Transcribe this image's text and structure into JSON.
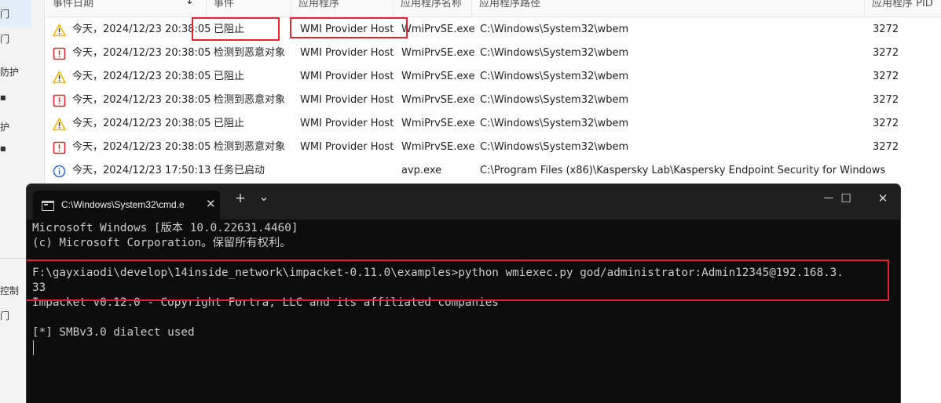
{
  "sidebar": {
    "fragments": [
      "门",
      "门",
      "防护",
      "■",
      "护",
      "■",
      "控制",
      "门"
    ]
  },
  "table": {
    "columns": [
      "事件日期",
      "事件",
      "应用程序",
      "应用程序名称",
      "应用程序路径",
      "应用程序 PID"
    ],
    "sort_arrow": "↓",
    "rows": [
      {
        "icon": "warning",
        "date": "今天，2024/12/23 20:38:05",
        "event": "已阻止",
        "app": "WMI Provider Host",
        "name": "WmiPrvSE.exe",
        "path": "C:\\Windows\\System32\\wbem",
        "pid": "3272"
      },
      {
        "icon": "error",
        "date": "今天，2024/12/23 20:38:05",
        "event": "检测到恶意对象",
        "app": "WMI Provider Host",
        "name": "WmiPrvSE.exe",
        "path": "C:\\Windows\\System32\\wbem",
        "pid": "3272"
      },
      {
        "icon": "warning",
        "date": "今天，2024/12/23 20:38:05",
        "event": "已阻止",
        "app": "WMI Provider Host",
        "name": "WmiPrvSE.exe",
        "path": "C:\\Windows\\System32\\wbem",
        "pid": "3272"
      },
      {
        "icon": "error",
        "date": "今天，2024/12/23 20:38:05",
        "event": "检测到恶意对象",
        "app": "WMI Provider Host",
        "name": "WmiPrvSE.exe",
        "path": "C:\\Windows\\System32\\wbem",
        "pid": "3272"
      },
      {
        "icon": "warning",
        "date": "今天，2024/12/23 20:38:05",
        "event": "已阻止",
        "app": "WMI Provider Host",
        "name": "WmiPrvSE.exe",
        "path": "C:\\Windows\\System32\\wbem",
        "pid": "3272"
      },
      {
        "icon": "error",
        "date": "今天，2024/12/23 20:38:05",
        "event": "检测到恶意对象",
        "app": "WMI Provider Host",
        "name": "WmiPrvSE.exe",
        "path": "C:\\Windows\\System32\\wbem",
        "pid": "3272"
      },
      {
        "icon": "info",
        "date": "今天，2024/12/23 17:50:13",
        "event": "任务已启动",
        "app": "",
        "name": "avp.exe",
        "path": "C:\\Program Files (x86)\\Kaspersky Lab\\Kaspersky Endpoint Security for Windows",
        "pid": ""
      }
    ]
  },
  "cmd": {
    "tab_title": "C:\\Windows\\System32\\cmd.e",
    "tab_close": "✕",
    "new_tab": "+",
    "dropdown": "⌄",
    "minimize": "—",
    "maximize": "☐",
    "close": "✕",
    "lines": [
      "Microsoft Windows [版本 10.0.22631.4460]",
      "(c) Microsoft Corporation。保留所有权利。",
      "",
      "F:\\gayxiaodi\\develop\\14inside_network\\impacket-0.11.0\\examples>python wmiexec.py god/administrator:Admin12345@192.168.3.",
      "33",
      "Impacket v0.12.0 - Copyright Fortra, LLC and its affiliated companies",
      "",
      "[*] SMBv3.0 dialect used"
    ]
  },
  "colors": {
    "highlight": "#e0252e",
    "warning": "#f2b705",
    "error": "#d42a2a",
    "info": "#2f6fc9",
    "console_bg": "#0c0c0c"
  }
}
